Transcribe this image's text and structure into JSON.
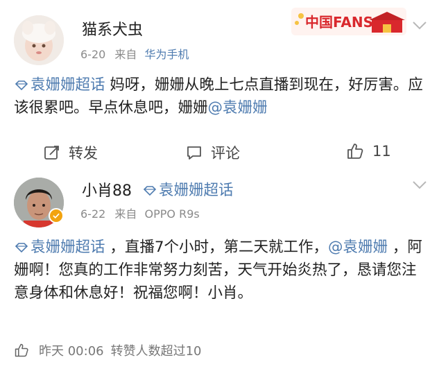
{
  "post1": {
    "username": "猫系犬虫",
    "date": "6-20",
    "source_prefix": "来自",
    "source": "华为手机",
    "badge_text": "中国FANS",
    "text": {
      "topic": "袁姗姗超话",
      "body": " 妈呀，姗姗从晚上七点直播到现在，好厉害。应该很累吧。早点休息吧，姗姗",
      "mention": "@袁姗姗"
    },
    "actions": {
      "repost_label": "转发",
      "comment_label": "评论",
      "like_count": "11"
    }
  },
  "post2": {
    "username": "小肖88",
    "topic_tag": "袁姗姗超话",
    "date": "6-22",
    "source_prefix": "来自",
    "source": "OPPO R9s",
    "text": {
      "topic": "袁姗姗超话",
      "body1": " ，直播7个小时，第二天就工作，",
      "mention": "@袁姗姗",
      "body2": " ，阿姗啊！您真的工作非常努力刻苦，天气开始炎热了，恳请您注意身体和休息好！祝福您啊！小肖。"
    },
    "footer": {
      "time_label": "昨天 00:06",
      "likes_text": "转赞人数超过10"
    }
  },
  "colors": {
    "link": "#4f7cb0",
    "badge_red": "#d9282d",
    "verified": "#f2a30f"
  },
  "icons": [
    "diamond-topic-icon",
    "chevron-down-icon",
    "repost-icon",
    "comment-icon",
    "like-icon",
    "verified-badge-icon"
  ]
}
